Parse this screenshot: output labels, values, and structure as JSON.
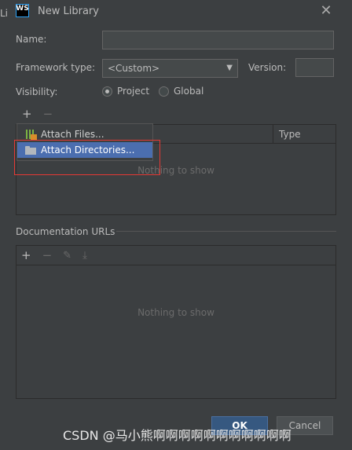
{
  "window": {
    "title": "New Library",
    "app_logo": "WS",
    "behind_text": "Li"
  },
  "fields": {
    "name_label": "Name:",
    "name_value": "",
    "framework_label": "Framework type:",
    "framework_value": "<Custom>",
    "version_label": "Version:",
    "version_value": "",
    "visibility_label": "Visibility:",
    "visibility_options": [
      "Project",
      "Global"
    ],
    "visibility_selected": "Project"
  },
  "roots_panel": {
    "add_icon": "+",
    "remove_icon": "−",
    "column_type": "Type",
    "empty_text": "Nothing to show"
  },
  "attach_menu": {
    "items": [
      {
        "label": "Attach Files...",
        "icon": "jar-icon"
      },
      {
        "label": "Attach Directories...",
        "icon": "folder-icon"
      }
    ],
    "highlighted_index": 1
  },
  "doc_section": {
    "title": "Documentation URLs",
    "empty_text": "Nothing to show",
    "toolbar": [
      "add-icon",
      "remove-icon",
      "edit-icon",
      "download-icon"
    ]
  },
  "buttons": {
    "ok": "OK",
    "cancel": "Cancel"
  },
  "watermark": "CSDN @马小熊啊啊啊啊啊啊啊啊啊啊啊"
}
